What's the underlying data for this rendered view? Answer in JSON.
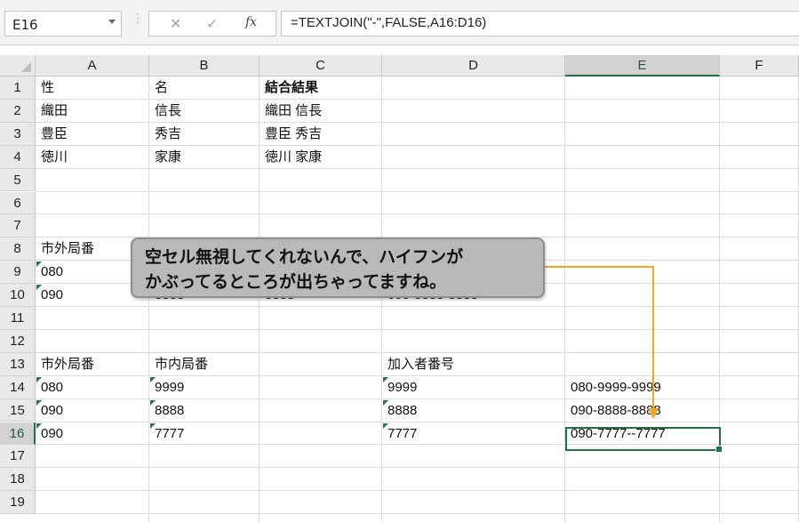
{
  "formula_bar": {
    "name_box": "E16",
    "cancel_symbol": "✕",
    "enter_symbol": "✓",
    "fx_label": "fx",
    "formula": "=TEXTJOIN(\"-\",FALSE,A16:D16)"
  },
  "columns": [
    "A",
    "B",
    "C",
    "D",
    "E",
    "F"
  ],
  "selected_column": "E",
  "rows": [
    "1",
    "2",
    "3",
    "4",
    "5",
    "6",
    "7",
    "8",
    "9",
    "10",
    "11",
    "12",
    "13",
    "14",
    "15",
    "16",
    "17",
    "18",
    "19"
  ],
  "selected_row": "16",
  "cells": {
    "A1": "性",
    "B1": "名",
    "C1": "結合結果",
    "A2": "織田",
    "B2": "信長",
    "C2": "織田 信長",
    "A3": "豊臣",
    "B3": "秀吉",
    "C3": "豊臣 秀吉",
    "A4": "徳川",
    "B4": "家康",
    "C4": "徳川 家康",
    "A8": "市外局番",
    "A9": "080",
    "A10": "090",
    "B10": "8888",
    "C10": "8888",
    "D10": "090-8888-8888",
    "A13": "市外局番",
    "B13": "市内局番",
    "D13": "加入者番号",
    "A14": "080",
    "B14": "9999",
    "D14": "9999",
    "E14": "080-9999-9999",
    "A15": "090",
    "B15": "8888",
    "D15": "8888",
    "E15": "090-8888-8888",
    "A16": "090",
    "B16": "7777",
    "D16": "7777",
    "E16": "090-7777--7777"
  },
  "callout": {
    "line1": "空セル無視してくれないんで、ハイフンが",
    "line2": "かぶってるところが出ちゃってますね。"
  },
  "colors": {
    "selection": "#217346",
    "arrow": "#f5a623",
    "callout_fill": "#b9b9b9"
  }
}
